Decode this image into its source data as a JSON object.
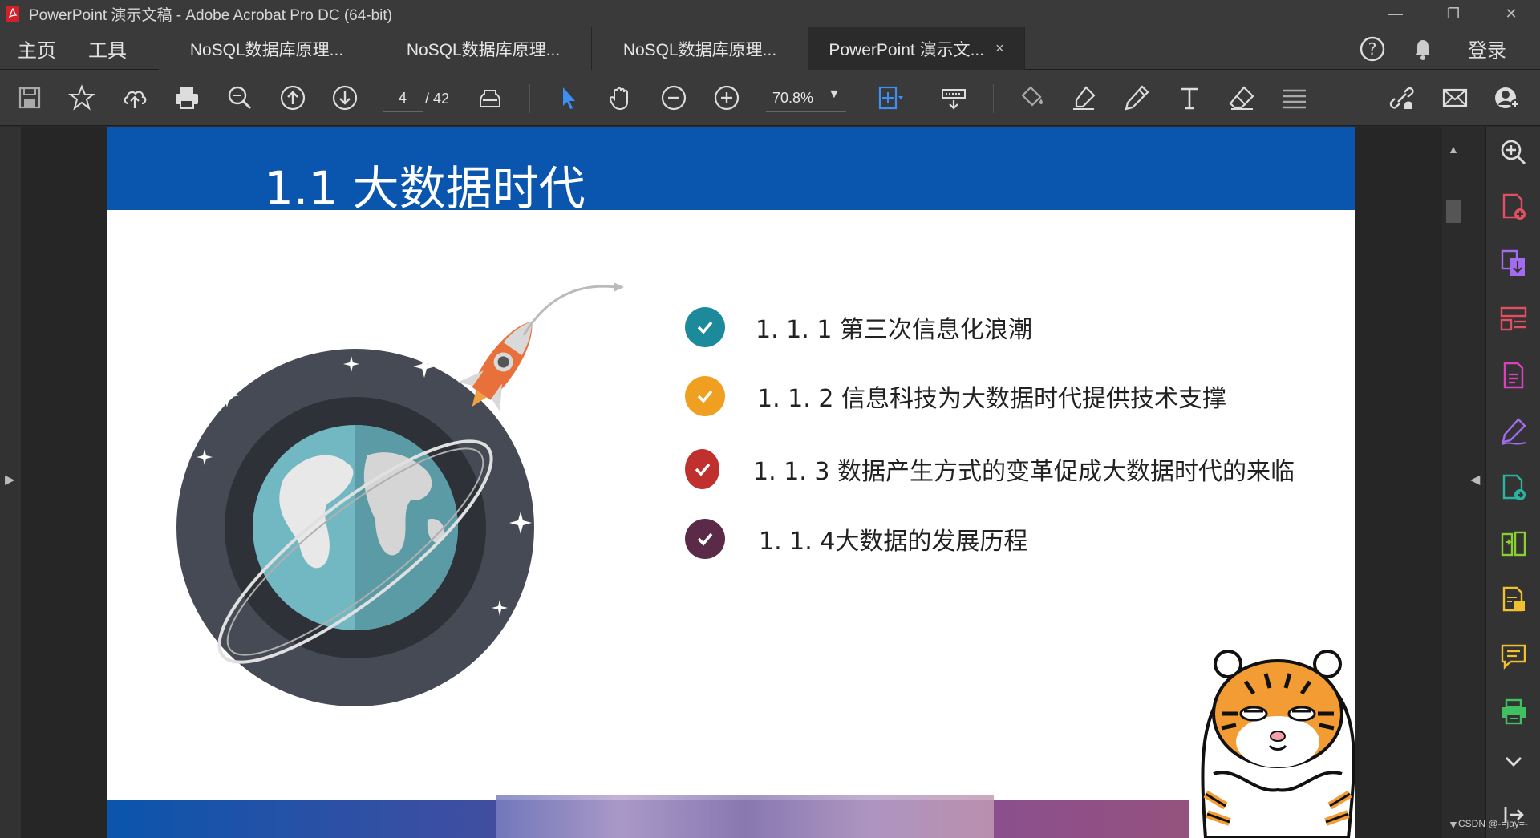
{
  "window": {
    "title": "PowerPoint 演示文稿 - Adobe Acrobat Pro DC (64-bit)",
    "controls": {
      "minimize": "—",
      "restore": "❐",
      "close": "✕"
    }
  },
  "menubar": {
    "home": "主页",
    "tools": "工具",
    "tabs": [
      {
        "label": "NoSQL数据库原理...",
        "active": false
      },
      {
        "label": "NoSQL数据库原理...",
        "active": false
      },
      {
        "label": "NoSQL数据库原理...",
        "active": false
      },
      {
        "label": "PowerPoint 演示文...",
        "active": true
      }
    ],
    "tab_close": "×",
    "help_icon": "help-icon",
    "bell_icon": "bell-icon",
    "login": "登录"
  },
  "toolbar": {
    "current_page": "4",
    "total_pages": "/ 42",
    "zoom": "70.8%",
    "icons": [
      "save-icon",
      "star-icon",
      "cloud-upload-icon",
      "print-icon",
      "zoom-search-icon",
      "page-up-icon",
      "page-down-icon",
      "ink-icon",
      "select-arrow-icon",
      "hand-icon",
      "zoom-out-icon",
      "zoom-in-icon",
      "fit-page-icon",
      "keyboard-icon",
      "fill-sign-icon",
      "highlight-icon",
      "pencil-icon",
      "text-icon",
      "eraser-icon",
      "lines-icon",
      "share-link-icon",
      "email-icon",
      "add-user-icon"
    ]
  },
  "slide": {
    "title": "1.1 大数据时代",
    "bullets": [
      {
        "text": "1. 1. 1  第三次信息化浪潮",
        "color": "#1c8a9a"
      },
      {
        "text": "1. 1. 2  信息科技为大数据时代提供技术支撑",
        "color": "#f0a020"
      },
      {
        "text": "1. 1. 3  数据产生方式的变革促成大数据时代的来临",
        "color": "#c0302e"
      },
      {
        "text": "1. 1. 4大数据的发展历程",
        "color": "#5a2a48"
      }
    ],
    "header_color": "#0a55ad"
  },
  "rightpanel": {
    "icons": [
      "zoom-panel-icon",
      "create-pdf-icon",
      "export-pdf-icon",
      "organize-pages-icon",
      "edit-pdf-icon",
      "sign-icon",
      "combine-icon",
      "compress-icon",
      "request-signature-icon",
      "comment-icon",
      "print-production-icon",
      "more-tools-chevron-icon",
      "collapse-panel-icon"
    ]
  },
  "watermark": "CSDN @-=jay=-"
}
